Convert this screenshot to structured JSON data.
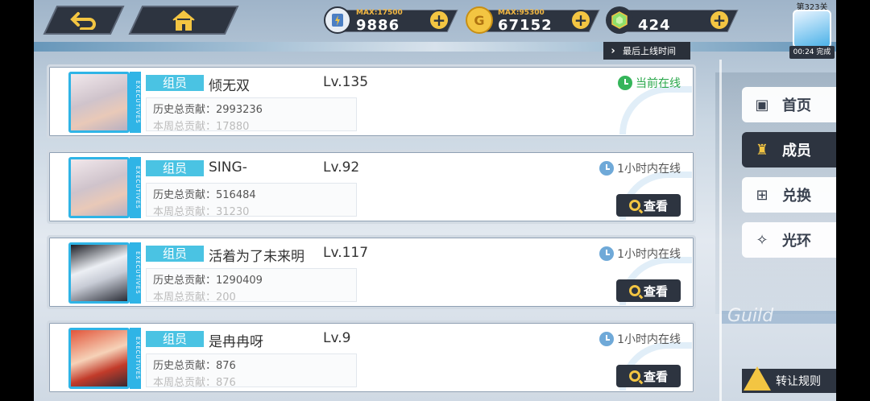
{
  "topbar": {
    "resources": [
      {
        "name": "stamina",
        "icon": "stamina-icon",
        "max": "MAX:17500",
        "value": "9886"
      },
      {
        "name": "gold",
        "icon": "gold-coin-icon",
        "max": "MAX:95300",
        "value": "67152"
      },
      {
        "name": "gem",
        "icon": "gem-icon",
        "max": "",
        "value": "424"
      }
    ],
    "stage": {
      "label": "第323关",
      "timer": "00:24 完成"
    },
    "sort_label": "最后上线时间"
  },
  "members": [
    {
      "role": "组员",
      "name": "倾无双",
      "level": "Lv.135",
      "history": "历史总贡献：2993236",
      "weekly": "本周总贡献：17880",
      "status": "当前在线",
      "online": true,
      "executives": "EXECUTIVES"
    },
    {
      "role": "组员",
      "name": "SING-",
      "level": "Lv.92",
      "history": "历史总贡献：516484",
      "weekly": "本周总贡献：31230",
      "status": "1小时内在线",
      "online": false,
      "view": "查看",
      "executives": "EXECUTIVES"
    },
    {
      "role": "组员",
      "name": "活着为了未来明",
      "level": "Lv.117",
      "history": "历史总贡献：1290409",
      "weekly": "本周总贡献：200",
      "status": "1小时内在线",
      "online": false,
      "view": "查看",
      "executives": "EXECUTIVES"
    },
    {
      "role": "组员",
      "name": "是冉冉呀",
      "level": "Lv.9",
      "history": "历史总贡献：876",
      "weekly": "本周总贡献：876",
      "status": "1小时内在线",
      "online": false,
      "view": "查看",
      "executives": "EXECUTIVES"
    }
  ],
  "tabs": [
    {
      "label": "首页",
      "icon": "home-card-icon"
    },
    {
      "label": "成员",
      "icon": "members-icon"
    },
    {
      "label": "兑换",
      "icon": "exchange-icon"
    },
    {
      "label": "光环",
      "icon": "halo-icon"
    }
  ],
  "guild_watermark": "Guild",
  "transfer_rules": "转让规则",
  "colors": {
    "accent": "#4ac3e3",
    "dark": "#2d3440",
    "gold": "#f3c542",
    "online": "#2aa84b"
  }
}
